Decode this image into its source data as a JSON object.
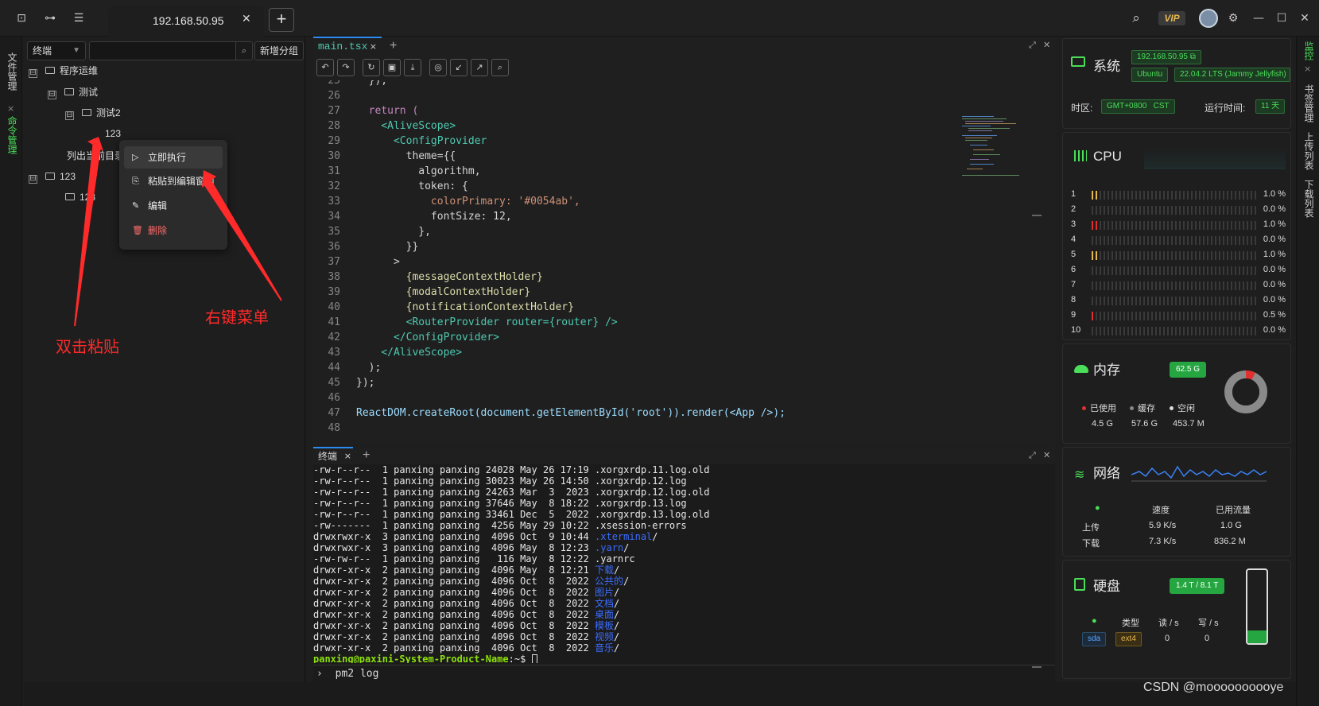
{
  "titlebar": {
    "host_tab": "192.168.50.95",
    "icons": [
      "terminal-icon",
      "tree-icon",
      "list-icon",
      "search-icon",
      "gear-icon",
      "minimize-icon",
      "maximize-icon",
      "close-icon"
    ],
    "vip": "VIP"
  },
  "left_rail": {
    "items": [
      "文件管理",
      "命令管理"
    ],
    "close": "×"
  },
  "right_rail": {
    "items": [
      "监控",
      "书签管理",
      "上传列表",
      "下载列表"
    ],
    "close": "×"
  },
  "command_panel": {
    "select_value": "终端",
    "search_placeholder": "",
    "add_group_label": "新增分组",
    "tree": [
      {
        "label": "程序运维",
        "toggle": "⊟"
      },
      {
        "label": "测试",
        "toggle": "⊟"
      },
      {
        "label": "测试2",
        "toggle": "⊟"
      },
      {
        "label": "123"
      },
      {
        "label": "列出当前目录"
      },
      {
        "label": "123",
        "toggle": "⊟"
      },
      {
        "label": "123"
      }
    ],
    "context_menu": [
      {
        "label": "立即执行",
        "icon": "play-icon"
      },
      {
        "label": "粘贴到编辑窗口",
        "icon": "paste-icon"
      },
      {
        "label": "编辑",
        "icon": "edit-icon"
      },
      {
        "label": "删除",
        "icon": "delete-icon"
      }
    ]
  },
  "annotations": {
    "double_click": "双击粘贴",
    "right_click": "右键菜单",
    "accent": "#ff2a2a"
  },
  "editor": {
    "tab": "main.tsx",
    "tab_close": "×",
    "lines": [
      {
        "n": "25",
        "t": "  });"
      },
      {
        "n": "26",
        "t": ""
      },
      {
        "n": "27",
        "t": "  return ("
      },
      {
        "n": "28",
        "t": "    <AliveScope>"
      },
      {
        "n": "29",
        "t": "      <ConfigProvider"
      },
      {
        "n": "30",
        "t": "        theme={{"
      },
      {
        "n": "31",
        "t": "          algorithm,"
      },
      {
        "n": "32",
        "t": "          token: {"
      },
      {
        "n": "33",
        "t": "            colorPrimary: '#0054ab',"
      },
      {
        "n": "34",
        "t": "            fontSize: 12,"
      },
      {
        "n": "35",
        "t": "          },"
      },
      {
        "n": "36",
        "t": "        }}"
      },
      {
        "n": "37",
        "t": "      >"
      },
      {
        "n": "38",
        "t": "        {messageContextHolder}"
      },
      {
        "n": "39",
        "t": "        {modalContextHolder}"
      },
      {
        "n": "40",
        "t": "        {notificationContextHolder}"
      },
      {
        "n": "41",
        "t": "        <RouterProvider router={router} />"
      },
      {
        "n": "42",
        "t": "      </ConfigProvider>"
      },
      {
        "n": "43",
        "t": "    </AliveScope>"
      },
      {
        "n": "44",
        "t": "  );"
      },
      {
        "n": "45",
        "t": "});"
      },
      {
        "n": "46",
        "t": ""
      },
      {
        "n": "47",
        "t": "ReactDOM.createRoot(document.getElementById('root')).render(<App />);"
      },
      {
        "n": "48",
        "t": ""
      }
    ]
  },
  "terminal": {
    "tab": "终端",
    "tab_close": "×",
    "lines": [
      {
        "t": "-rw-r--r--  1 panxing panxing 24028 May 26 17:19 ",
        "f": ".xorgxrdp.11.log.old"
      },
      {
        "t": "-rw-r--r--  1 panxing panxing 30023 May 26 14:50 ",
        "f": ".xorgxrdp.12.log"
      },
      {
        "t": "-rw-r--r--  1 panxing panxing 24263 Mar  3  2023 ",
        "f": ".xorgxrdp.12.log.old"
      },
      {
        "t": "-rw-r--r--  1 panxing panxing 37646 May  8 18:22 ",
        "f": ".xorgxrdp.13.log"
      },
      {
        "t": "-rw-r--r--  1 panxing panxing 33461 Dec  5  2022 ",
        "f": ".xorgxrdp.13.log.old"
      },
      {
        "t": "-rw-------  1 panxing panxing  4256 May 29 10:22 ",
        "f": ".xsession-errors"
      },
      {
        "t": "drwxrwxr-x  3 panxing panxing  4096 Oct  9 10:44 ",
        "d": ".xterminal",
        "s": "/"
      },
      {
        "t": "drwxrwxr-x  3 panxing panxing  4096 May  8 12:23 ",
        "d": ".yarn",
        "s": "/"
      },
      {
        "t": "-rw-rw-r--  1 panxing panxing   116 May  8 12:22 ",
        "f": ".yarnrc"
      },
      {
        "t": "drwxr-xr-x  2 panxing panxing  4096 May  8 12:21 ",
        "d": "下载",
        "s": "/"
      },
      {
        "t": "drwxr-xr-x  2 panxing panxing  4096 Oct  8  2022 ",
        "d": "公共的",
        "s": "/"
      },
      {
        "t": "drwxr-xr-x  2 panxing panxing  4096 Oct  8  2022 ",
        "d": "图片",
        "s": "/"
      },
      {
        "t": "drwxr-xr-x  2 panxing panxing  4096 Oct  8  2022 ",
        "d": "文档",
        "s": "/"
      },
      {
        "t": "drwxr-xr-x  2 panxing panxing  4096 Oct  8  2022 ",
        "d": "桌面",
        "s": "/"
      },
      {
        "t": "drwxr-xr-x  2 panxing panxing  4096 Oct  8  2022 ",
        "d": "模板",
        "s": "/"
      },
      {
        "t": "drwxr-xr-x  2 panxing panxing  4096 Oct  8  2022 ",
        "d": "视频",
        "s": "/"
      },
      {
        "t": "drwxr-xr-x  2 panxing panxing  4096 Oct  8  2022 ",
        "d": "音乐",
        "s": "/"
      }
    ],
    "prompt": "panxing@paxini-System-Product-Name",
    "prompt_suffix": ":~$ ",
    "input_caret": "›",
    "input": "pm2 log"
  },
  "monitor": {
    "system": {
      "title": "系统",
      "ip": "192.168.50.95",
      "os": "Ubuntu",
      "version": "22.04.2 LTS (Jammy Jellyfish)",
      "tz_label": "时区:",
      "tz": "GMT+0800   CST",
      "uptime_label": "运行时间:",
      "uptime": "11 天"
    },
    "cpu": {
      "title": "CPU",
      "cores": [
        {
          "n": "1",
          "v": "1.0 %",
          "p": 0.01
        },
        {
          "n": "2",
          "v": "0.0 %",
          "p": 0.0
        },
        {
          "n": "3",
          "v": "1.0 %",
          "p": 0.01
        },
        {
          "n": "4",
          "v": "0.0 %",
          "p": 0.0
        },
        {
          "n": "5",
          "v": "1.0 %",
          "p": 0.01
        },
        {
          "n": "6",
          "v": "0.0 %",
          "p": 0.0
        },
        {
          "n": "7",
          "v": "0.0 %",
          "p": 0.0
        },
        {
          "n": "8",
          "v": "0.0 %",
          "p": 0.0
        },
        {
          "n": "9",
          "v": "0.5 %",
          "p": 0.005
        },
        {
          "n": "10",
          "v": "0.0 %",
          "p": 0.0
        }
      ]
    },
    "memory": {
      "title": "内存",
      "total": "62.5 G",
      "used_label": "已使用",
      "used": "4.5 G",
      "cache_label": "缓存",
      "cache": "57.6 G",
      "free_label": "空闲",
      "free": "453.7 M",
      "used_fraction": 0.072
    },
    "network": {
      "title": "网络",
      "speed_label": "速度",
      "traffic_label": "已用流量",
      "up_label": "上传",
      "up_speed": "5.9 K/s",
      "up_total": "1.0 G",
      "down_label": "下载",
      "down_speed": "7.3 K/s",
      "down_total": "836.2 M"
    },
    "disk": {
      "title": "硬盘",
      "size": "1.4 T / 8.1 T",
      "type_label": "类型",
      "read_label": "读 / s",
      "write_label": "写 / s",
      "dev": "sda",
      "fs": "ext4",
      "read": "0",
      "write": "0",
      "used_fraction": 0.17
    }
  },
  "watermark": "CSDN @moooooooooye",
  "colors": {
    "accent": "#2d8cf0",
    "green": "#4ade5a",
    "dir_blue": "#3b6dff",
    "cpu_red": "#e03030"
  }
}
